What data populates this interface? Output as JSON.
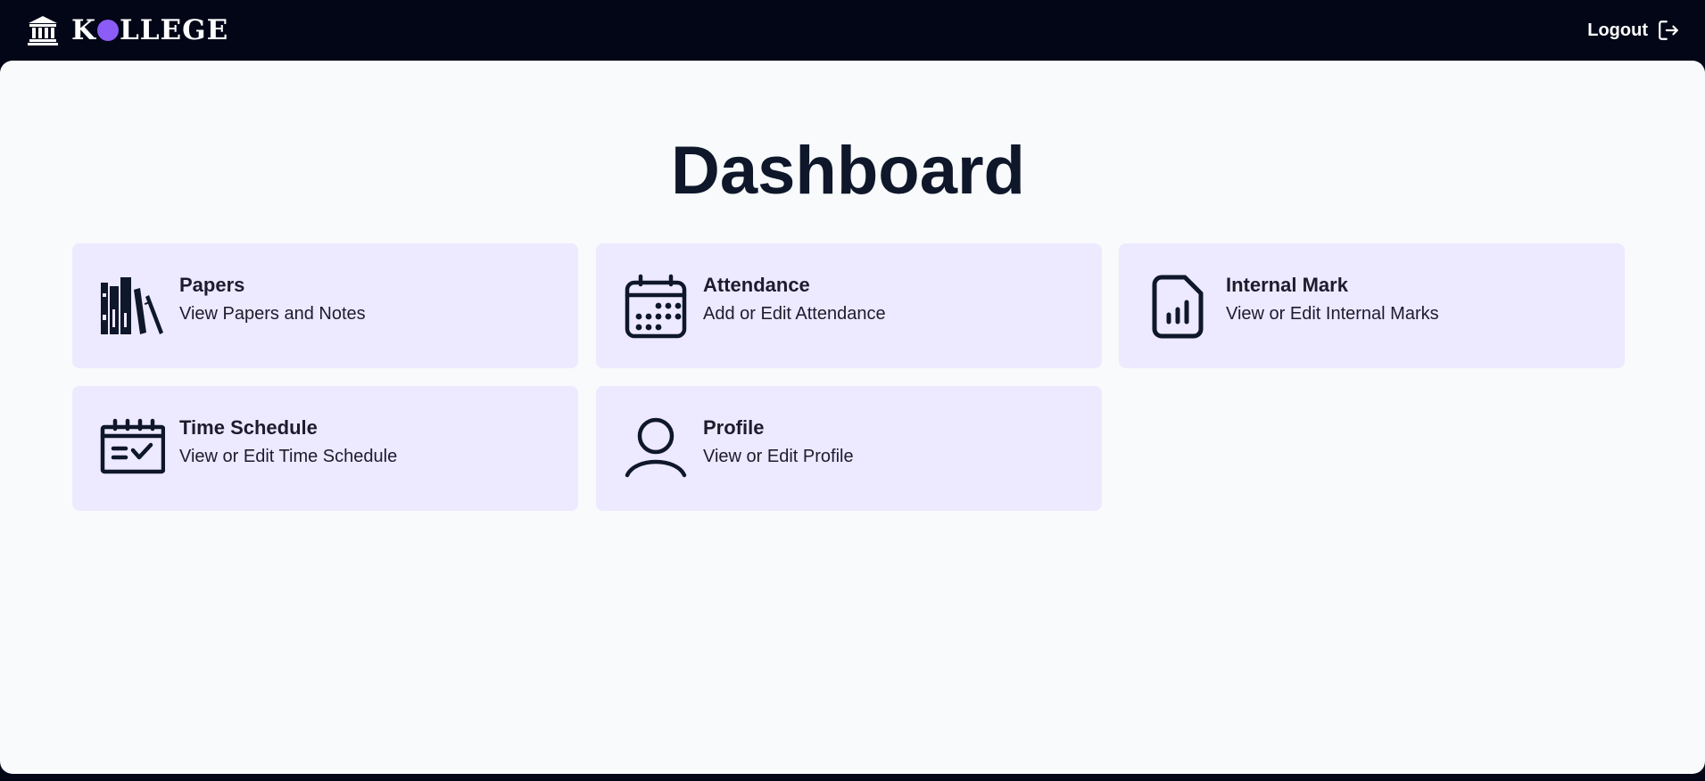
{
  "header": {
    "brand_left": "K",
    "brand_right": "LLEGE",
    "brand_icon": "institution-icon",
    "logout_label": "Logout",
    "logout_icon": "logout-icon"
  },
  "main": {
    "title": "Dashboard",
    "cards": [
      {
        "title": "Papers",
        "description": "View Papers and Notes",
        "icon": "books-icon"
      },
      {
        "title": "Attendance",
        "description": "Add or Edit Attendance",
        "icon": "calendar-icon"
      },
      {
        "title": "Internal Mark",
        "description": "View or Edit Internal Marks",
        "icon": "chart-document-icon"
      },
      {
        "title": "Time Schedule",
        "description": "View or Edit Time Schedule",
        "icon": "schedule-check-icon"
      },
      {
        "title": "Profile",
        "description": "View or Edit Profile",
        "icon": "user-icon"
      }
    ]
  },
  "colors": {
    "topbar": "#030617",
    "card_bg": "#ede9fe",
    "accent_dot": "#8b5cf6",
    "page_bg": "#f8fafc",
    "text": "#0f172a"
  }
}
